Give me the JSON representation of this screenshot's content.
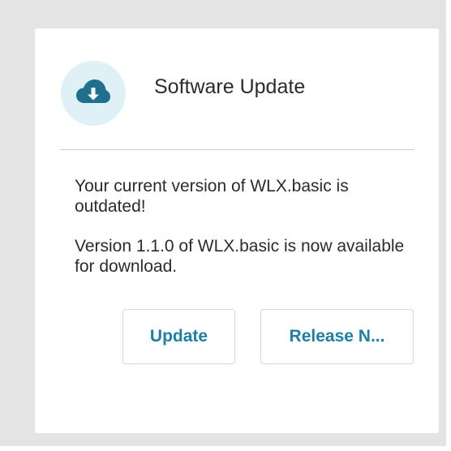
{
  "dialog": {
    "title": "Software Update",
    "icon": "cloud-download-icon",
    "messages": [
      "Your current version of WLX.basic is outdated!",
      "Version 1.1.0 of WLX.basic is now available for download."
    ],
    "buttons": {
      "update_label": "Update",
      "release_notes_label": "Release N..."
    }
  },
  "colors": {
    "backdrop": "#e4e4e4",
    "card": "#ffffff",
    "icon_circle": "#dff0f7",
    "icon": "#1f6f8e",
    "accent": "#1e7fa6",
    "text": "#2b2b2b",
    "divider": "#cfcfcf"
  }
}
